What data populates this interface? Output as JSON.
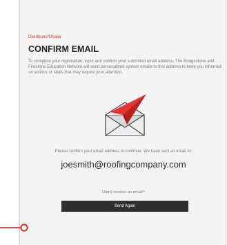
{
  "header": {
    "eyebrow": "Distributor/Dealer",
    "title": "CONFIRM EMAIL"
  },
  "main": {
    "description": "To complete your registration, input and confirm your submitted email address. The Bridgestone and Firestone Education Network will send personalized system emails to this address to keep you informed on actions or tasks that may require your attention.",
    "illustration_icon": "envelope-paper-plane-icon",
    "confirm_text": "Please confirm your email address to continue. We have sent an email to:",
    "email": "joesmith@roofingcompany.com",
    "no_email_text": "Didn't receive an email?",
    "send_again_label": "Send Again"
  },
  "colors": {
    "accent": "#d9322b",
    "button_bg": "#2f2f2f",
    "card_bg": "#f4f4f4"
  }
}
